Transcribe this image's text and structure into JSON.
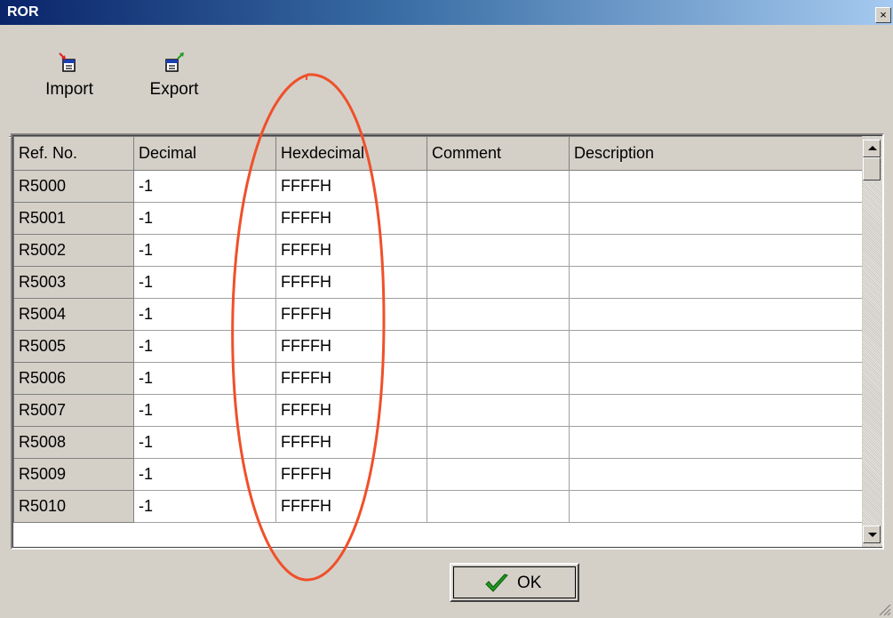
{
  "window": {
    "title": "ROR",
    "close_glyph": "×"
  },
  "toolbar": {
    "import_label": "Import",
    "export_label": "Export",
    "import_icon": "import-icon",
    "export_icon": "export-icon"
  },
  "grid": {
    "columns": [
      "Ref. No.",
      "Decimal",
      "Hexdecimal",
      "Comment",
      "Description"
    ],
    "rows": [
      {
        "ref": "R5000",
        "decimal": "-1",
        "hex": "FFFFH",
        "comment": "",
        "description": ""
      },
      {
        "ref": "R5001",
        "decimal": "-1",
        "hex": "FFFFH",
        "comment": "",
        "description": ""
      },
      {
        "ref": "R5002",
        "decimal": "-1",
        "hex": "FFFFH",
        "comment": "",
        "description": ""
      },
      {
        "ref": "R5003",
        "decimal": "-1",
        "hex": "FFFFH",
        "comment": "",
        "description": ""
      },
      {
        "ref": "R5004",
        "decimal": "-1",
        "hex": "FFFFH",
        "comment": "",
        "description": ""
      },
      {
        "ref": "R5005",
        "decimal": "-1",
        "hex": "FFFFH",
        "comment": "",
        "description": ""
      },
      {
        "ref": "R5006",
        "decimal": "-1",
        "hex": "FFFFH",
        "comment": "",
        "description": ""
      },
      {
        "ref": "R5007",
        "decimal": "-1",
        "hex": "FFFFH",
        "comment": "",
        "description": ""
      },
      {
        "ref": "R5008",
        "decimal": "-1",
        "hex": "FFFFH",
        "comment": "",
        "description": ""
      },
      {
        "ref": "R5009",
        "decimal": "-1",
        "hex": "FFFFH",
        "comment": "",
        "description": ""
      },
      {
        "ref": "R5010",
        "decimal": "-1",
        "hex": "FFFFH",
        "comment": "",
        "description": ""
      }
    ]
  },
  "footer": {
    "ok_label": "OK",
    "ok_icon": "checkmark-icon"
  },
  "colors": {
    "title_start": "#0a246a",
    "title_end": "#a6caf0",
    "annotation": "#f0502a",
    "check": "#1f9a1f"
  }
}
